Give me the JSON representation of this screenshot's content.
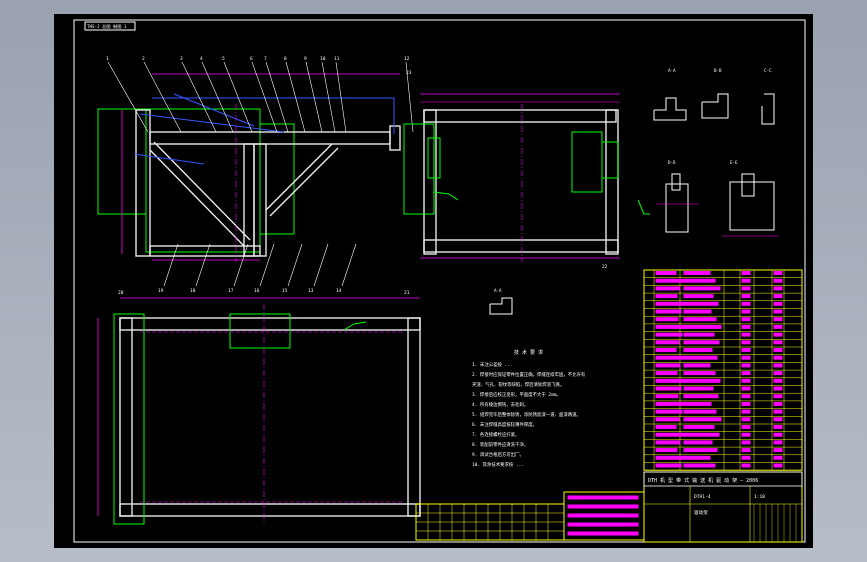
{
  "app": {
    "viewport_bg": "#a7aebb",
    "canvas_bg": "#000000"
  },
  "colors": {
    "frame": "#ffffff",
    "steel": "#e8e8e8",
    "outline": "#00ff00",
    "leader": "#ffffff",
    "hidden": "#3355ff",
    "dimension": "#ff00ff",
    "table": "#ffff00",
    "note": "#ffffff"
  },
  "drawing": {
    "tag": "THS-J 总图 制图 1",
    "balloons_top": [
      "1",
      "2",
      "3",
      "4",
      "5",
      "6",
      "7",
      "8",
      "9",
      "10",
      "11",
      "12"
    ],
    "balloons_side": [
      "19",
      "18",
      "17",
      "16",
      "15",
      "13",
      "14"
    ],
    "balloons_right": [
      "22",
      "23"
    ],
    "section_labels": [
      "A-A",
      "B-B",
      "C-C",
      "D-D",
      "E-E"
    ],
    "notes_title": "技 术 要 求",
    "notes": [
      "1. 未注公差按 ...",
      "2. 焊接时应保证零件位置正确，焊缝连续牢固，不允许有",
      "   夹渣、气孔、裂纹等缺陷，焊后清除焊渣飞溅。",
      "3. 焊接后应校正变形，平面度不大于 2mm。",
      "4. 所有棱边倒钝，去毛刺。",
      "5. 组焊完毕后整体除锈，涂防锈底漆一道、面漆两道。",
      "6. 未注焊缝高度按较薄件厚度。",
      "7. 各连接螺栓应拧紧。",
      "8. 装配前零件应清洗干净。",
      "9. 调试合格后方可出厂。",
      "10. 其余技术要求按 ..."
    ],
    "title_block": {
      "main_title": "DTH 机 型 带 式 输 送 机 驱 动 架 — 2006",
      "drawing_no": "DTH1-4",
      "name": "驱动架",
      "scale_label": "1:10"
    }
  }
}
